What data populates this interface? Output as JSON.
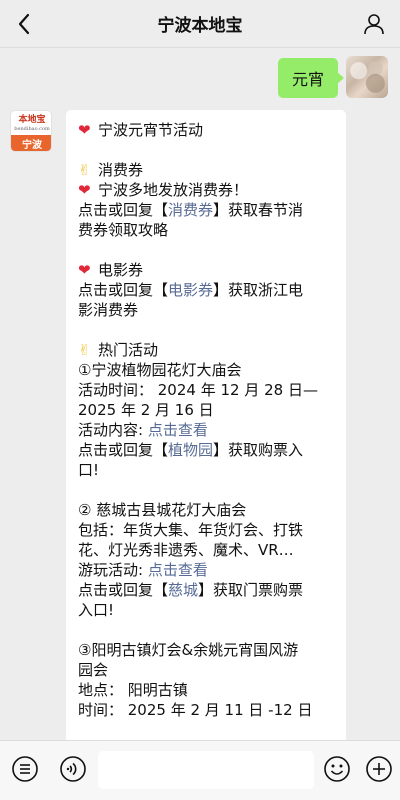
{
  "header": {
    "title": "宁波本地宝"
  },
  "icons": {
    "back": "chevron-left-icon",
    "profile": "person-icon",
    "menu": "menu-list-icon",
    "voice": "voice-icon",
    "emoji": "smiley-icon",
    "add": "plus-circle-icon"
  },
  "user_message": {
    "text": "元宵"
  },
  "bot_avatar": {
    "logo_text": "本地宝",
    "logo_url_text": "bendibao.com",
    "city_label": "宁波"
  },
  "bot_message": {
    "title": "宁波元宵节活动",
    "voucher": {
      "heading": "消费券",
      "line1": "宁波多地发放消费券！",
      "reply_line_pre": "点击或回复【",
      "reply_link": "消费券",
      "reply_line_post": "】获取春节消",
      "reply_line2": "费券领取攻略"
    },
    "movie": {
      "heading": "电影券",
      "reply_line_pre": "点击或回复【",
      "reply_link": "电影券",
      "reply_line_post": "】获取浙江电",
      "reply_line2": "影消费券"
    },
    "hot": {
      "heading": "热门活动",
      "item1": {
        "title": "①宁波植物园花灯大庙会",
        "time_line1": "活动时间：  2024 年 12 月 28 日—",
        "time_line2": "2025 年 2 月 16 日",
        "content_label": "活动内容: ",
        "content_link": "点击查看",
        "reply_line_pre": "点击或回复【",
        "reply_link": "植物园",
        "reply_line_post": "】获取购票入",
        "reply_line2": "口!"
      },
      "item2": {
        "title": "② 慈城古县城花灯大庙会",
        "include_line1": "包括：年货大集、年货灯会、打铁",
        "include_line2": "花、灯光秀非遗秀、魔术、VR…",
        "play_label": "游玩活动: ",
        "play_link": "点击查看",
        "reply_line_pre": "点击或回复【",
        "reply_link": "慈城",
        "reply_line_post": "】获取门票购票",
        "reply_line2": "入口!"
      },
      "item3": {
        "title_line1": "③阳明古镇灯会&余姚元宵国风游",
        "title_line2": "园会",
        "place_line": "地点：  阳明古镇",
        "time_line": "时间：  2025 年 2 月 11 日 -12 日"
      }
    }
  }
}
